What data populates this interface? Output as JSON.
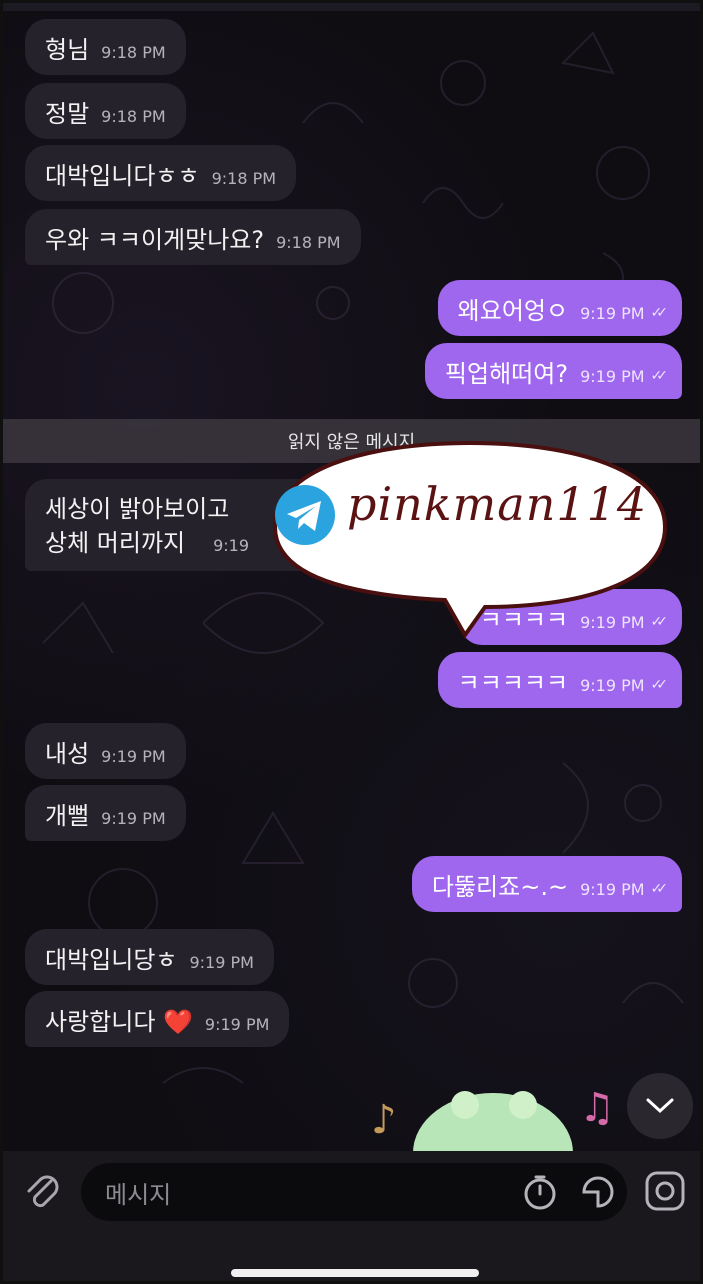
{
  "messages": [
    {
      "dir": "in",
      "text": "형님",
      "time": "9:18 PM"
    },
    {
      "dir": "in",
      "text": "정말",
      "time": "9:18 PM"
    },
    {
      "dir": "in",
      "text": "대박입니다ㅎㅎ",
      "time": "9:18 PM"
    },
    {
      "dir": "in",
      "text": "우와 ㅋㅋ이게맞나요?",
      "time": "9:18 PM"
    },
    {
      "dir": "out",
      "text": "왜요어엉ㅇ",
      "time": "9:19 PM"
    },
    {
      "dir": "out",
      "text": "픽업해떠여?",
      "time": "9:19 PM"
    },
    {
      "dir": "in",
      "line1": "세상이 밝아보이고",
      "line2": "상체 머리까지",
      "time": "9:19"
    },
    {
      "dir": "out",
      "text": "ㅋㅋㅋㅋ",
      "time": "9:19 PM"
    },
    {
      "dir": "out",
      "text": "ㅋㅋㅋㅋㅋ",
      "time": "9:19 PM"
    },
    {
      "dir": "in",
      "text": "내성",
      "time": "9:19 PM"
    },
    {
      "dir": "in",
      "text": "개뻘",
      "time": "9:19 PM"
    },
    {
      "dir": "out",
      "text": "다뚫리죠~.~",
      "time": "9:19 PM"
    },
    {
      "dir": "in",
      "text": "대박입니당ㅎ",
      "time": "9:19 PM"
    },
    {
      "dir": "in",
      "text": "사랑합니다 ❤️",
      "time": "9:19 PM"
    }
  ],
  "divider": {
    "label": "읽지 않은 메시지"
  },
  "watermark": {
    "text": "pinkman114"
  },
  "composer": {
    "placeholder": "메시지"
  },
  "colors": {
    "outgoing": "#9f67ee",
    "incoming": "#26222b",
    "background": "#0f0d12"
  },
  "icons": [
    "paperclip-icon",
    "timer-icon",
    "sticker-icon",
    "camera-icon",
    "chevron-down-icon",
    "telegram-icon",
    "music-note-icon"
  ]
}
